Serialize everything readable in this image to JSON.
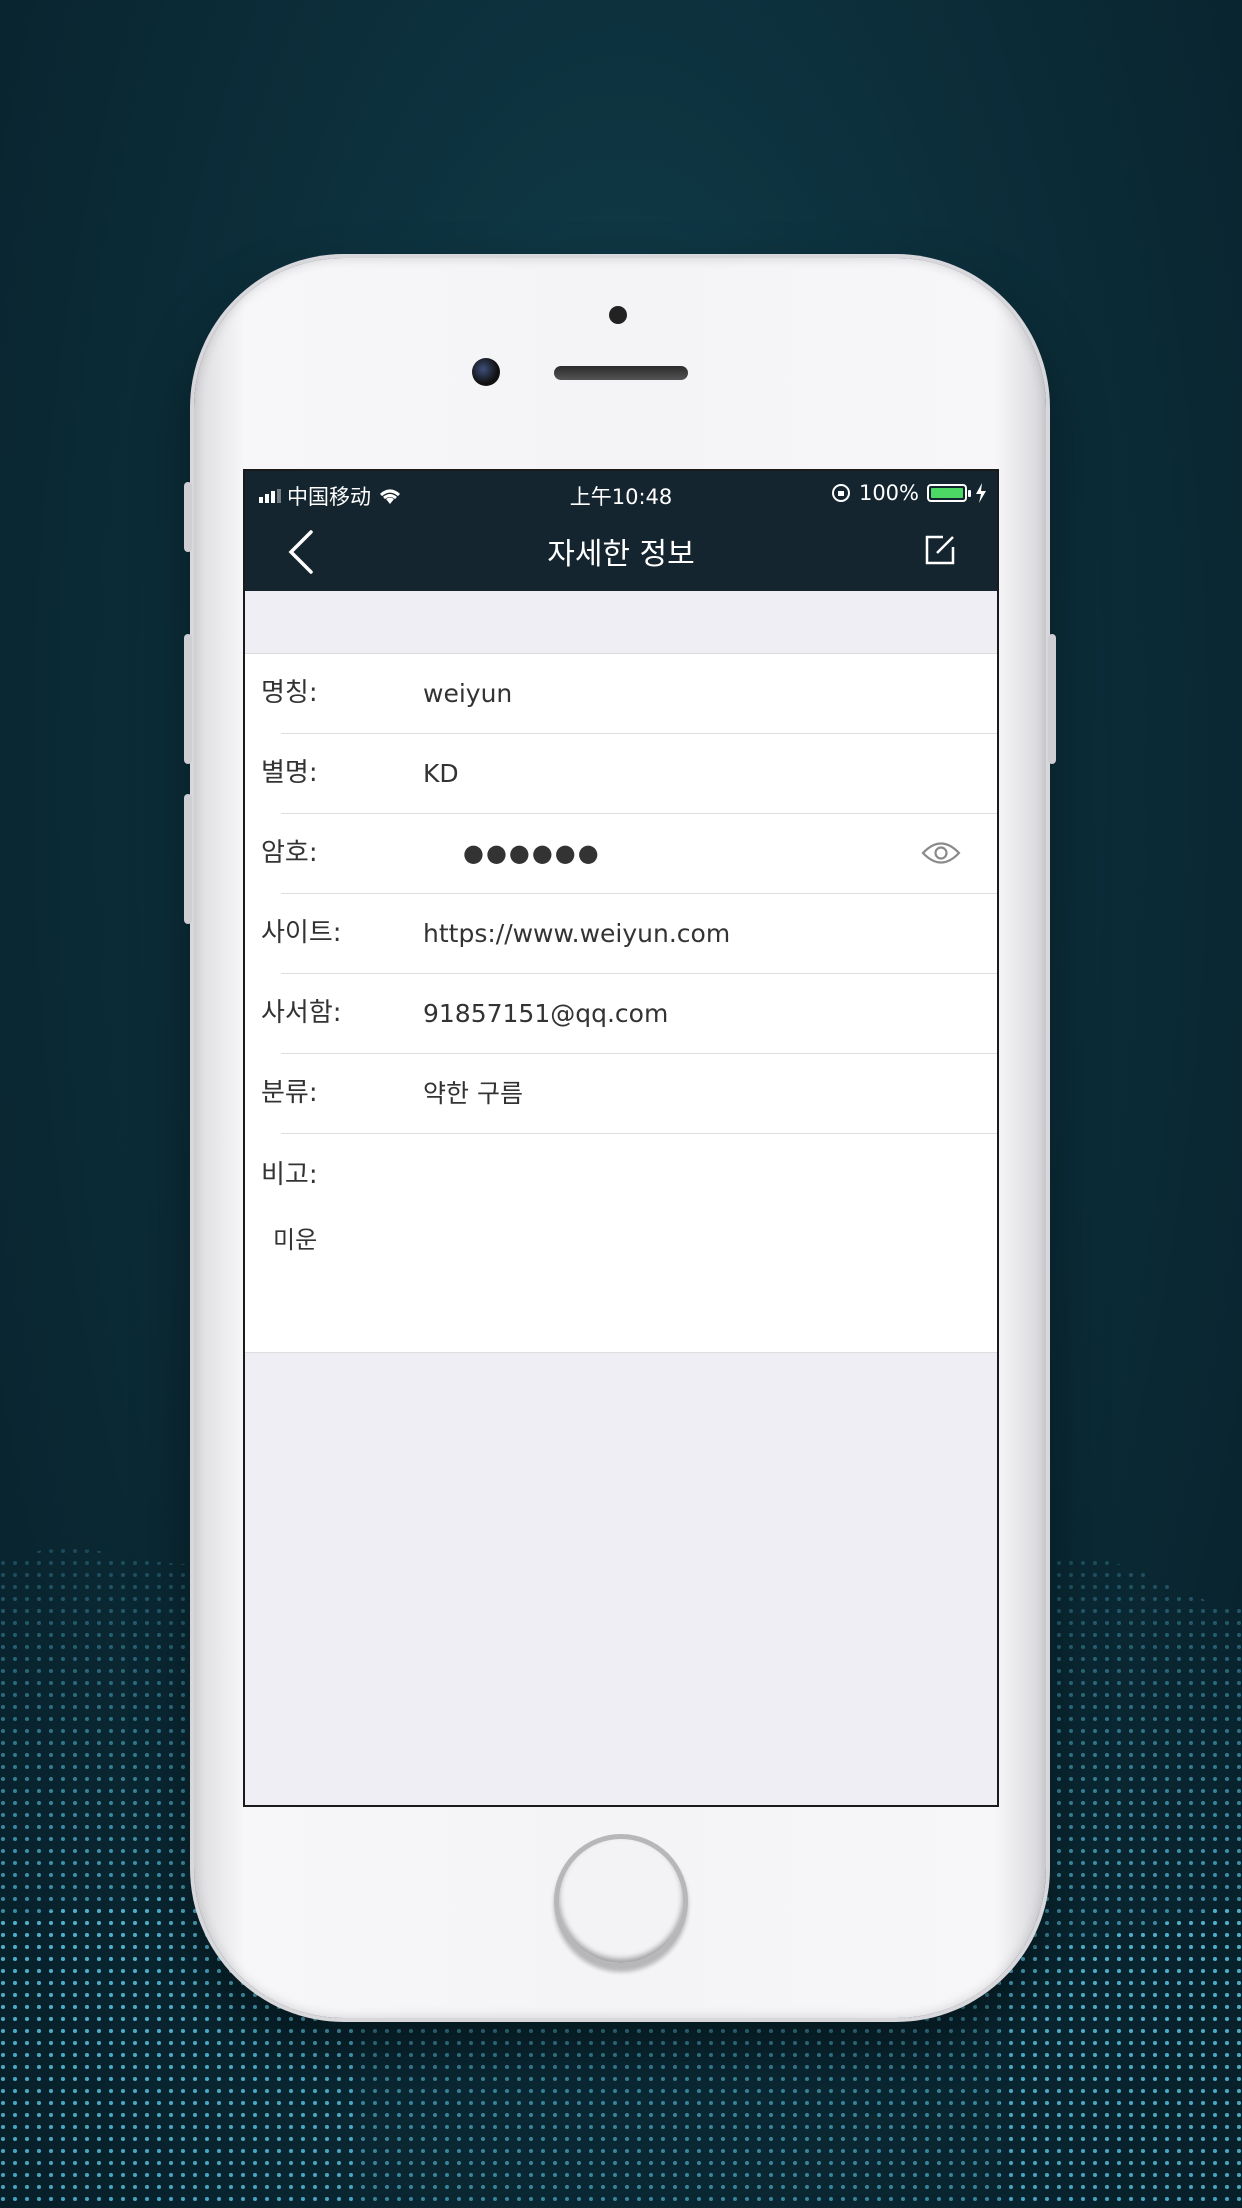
{
  "status_bar": {
    "carrier": "中国移动",
    "time": "上午10:48",
    "battery": "100%"
  },
  "navbar": {
    "title": "자세한 정보"
  },
  "fields": [
    {
      "label": "명칭:",
      "value": "weiyun"
    },
    {
      "label": "별명:",
      "value": "KD"
    },
    {
      "label": "암호:",
      "value": "●●●●●●"
    },
    {
      "label": "사이트:",
      "value": "https://www.weiyun.com"
    },
    {
      "label": "사서함:",
      "value": "91857151@qq.com"
    },
    {
      "label": "분류:",
      "value": "약한 구름"
    }
  ],
  "notes": {
    "label": "비고:",
    "value": "미운"
  },
  "icons": {
    "back": "chevron-left-icon",
    "edit": "edit-icon",
    "show_password": "eye-icon"
  },
  "colors": {
    "navbar": "#15252f",
    "screen_bg": "#efeef4",
    "battery": "#4cd964"
  }
}
